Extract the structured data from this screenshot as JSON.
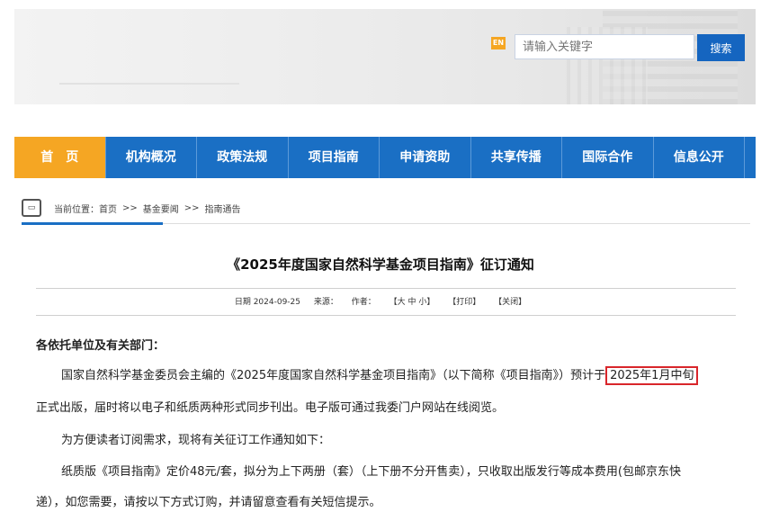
{
  "header": {
    "lang_icon": "EN",
    "search_placeholder": "请输入关键字",
    "search_button": "搜索"
  },
  "nav": [
    {
      "label": "首　页"
    },
    {
      "label": "机构概况"
    },
    {
      "label": "政策法规"
    },
    {
      "label": "项目指南"
    },
    {
      "label": "申请资助"
    },
    {
      "label": "共享传播"
    },
    {
      "label": "国际合作"
    },
    {
      "label": "信息公开"
    }
  ],
  "breadcrumb": {
    "prefix": "当前位置：首页",
    "sep": ">>",
    "level2": "基金要闻",
    "level3": "指南通告"
  },
  "article": {
    "title": "《2025年度国家自然科学基金项目指南》征订通知",
    "meta": {
      "date": "日期 2024-09-25",
      "source": "来源：",
      "author": "作者：",
      "font_size": "【大 中 小】",
      "print": "【打印】",
      "close": "【关闭】"
    },
    "salutation": "各依托单位及有关部门：",
    "p1a": "国家自然科学基金委员会主编的《2025年度国家自然科学基金项目指南》（以下简称《项目指南》）预计于",
    "p1_highlight": "2025年1月中旬",
    "p1b": "正式出版，届时将以电子和纸质两种形式同步刊出。电子版可通过我委门户网站在线阅览。",
    "p2": "为方便读者订阅需求，现将有关征订工作通知如下：",
    "p3a": "纸质版《项目指南》定价48元/套，拟分为上下两册（套）（上下册不分开售卖），只收取出版发行等成本费用(包邮京东快",
    "p3b": "递），如您需要，请按以下方式订购，并请留意查看有关短信提示。"
  },
  "colors": {
    "nav_bg": "#1a6fc4",
    "nav_active": "#f5a623",
    "highlight_border": "#d9262b"
  }
}
